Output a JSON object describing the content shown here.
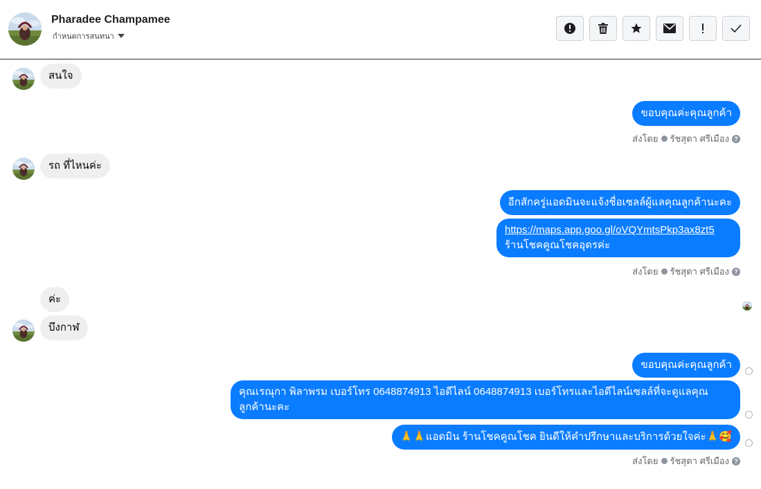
{
  "header": {
    "contact_name": "Pharadee Champamee",
    "subtitle": "กำหนดการสนทนา",
    "toolbar": [
      {
        "icon": "alert-circle-icon",
        "label": "Report spam"
      },
      {
        "icon": "trash-icon",
        "label": "Delete"
      },
      {
        "icon": "star-icon",
        "label": "Star"
      },
      {
        "icon": "envelope-icon",
        "label": "Mark as unread"
      },
      {
        "icon": "exclamation-icon",
        "label": "Mark as important"
      },
      {
        "icon": "checkmark-icon",
        "label": "Mark as done"
      }
    ]
  },
  "colors": {
    "outgoing": "#0a7cff",
    "incoming": "#efefef",
    "meta_text": "#65676b"
  },
  "messages": [
    {
      "from": "customer",
      "text": "สนใจ"
    },
    {
      "from": "page",
      "text": "ขอบคุณค่ะคุณลูกค้า"
    },
    {
      "from": "customer",
      "text": "รถ ที่ไหนค่ะ"
    },
    {
      "from": "page",
      "text": "อีกสักครู่แอดมินจะแจ้งชื่อเซลล์ผู้แลคุณลูกค้านะคะ"
    },
    {
      "from": "page",
      "link": "https://maps.app.goo.gl/oVQYmtsPkp3ax8zt5",
      "text": "ร้านโชคคูณโชคอุดรค่ะ"
    },
    {
      "from": "customer",
      "text": "ค่ะ"
    },
    {
      "from": "customer",
      "text": "บึงกาฬ"
    },
    {
      "from": "page",
      "text": "ขอบคุณค่ะคุณลูกค้า"
    },
    {
      "from": "page",
      "text": "คุณเรณุกา พิลาพรม        เบอร์โทร 0648874913  ไอดีไลน์ 0648874913   เบอร์โทรและไอดีไลน์เซลล์ที่จะดูแลคุณลูกค้านะคะ"
    },
    {
      "from": "page",
      "text": "🙏🙏แอดมิน ร้านโชคคูณโชค ยินดีให้คำปรึกษาและบริการด้วยใจค่ะ🙏🥰"
    }
  ],
  "sent_by": {
    "label": "ส่งโดย",
    "name": "รัชสุดา ศรีเมือง"
  }
}
